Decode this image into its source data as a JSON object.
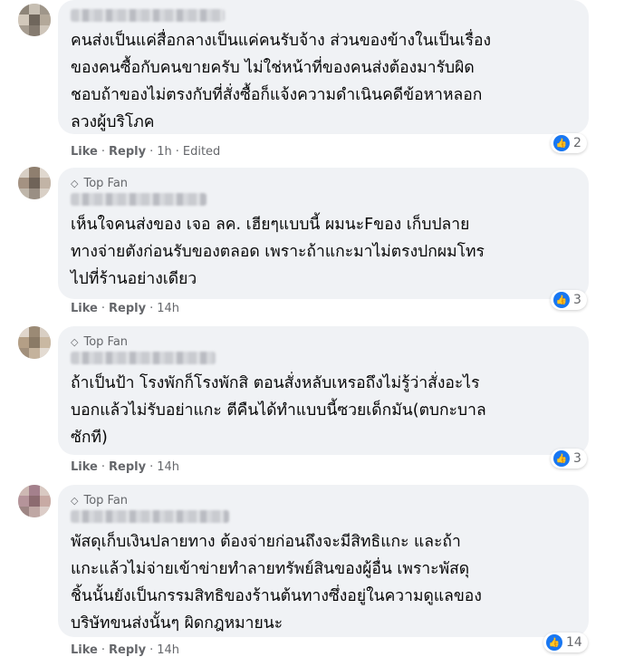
{
  "comments": [
    {
      "top_fan": false,
      "text": "คนส่งเป็นแค่สื่อกลางเป็นแค่คนรับจ้าง ส่วนของข้างในเป็นเรื่อง\nของคนซื้อกับคนขายครับ ไม่ใช่หน้าที่ของคนส่งต้องมารับผิด\nชอบถ้าของไม่ตรงกับที่สั่งซื้อก็แจ้งความดำเนินคดีข้อหาหลอก\nลวงผู้บริโภค",
      "like": "Like",
      "reply": "Reply",
      "time": "1h",
      "edited": "Edited",
      "reactions": "2"
    },
    {
      "top_fan": true,
      "badge": "Top Fan",
      "text": "เห็นใจคนส่งของ เจอ ลค. เฮียๆแบบนี้ ผมนะFของ เก็บปลาย\nทางจ่ายตังก่อนรับของตลอด เพราะถ้าแกะมาไม่ตรงปกผมโทร\nไปที่ร้านอย่างเดียว",
      "like": "Like",
      "reply": "Reply",
      "time": "14h",
      "reactions": "3"
    },
    {
      "top_fan": true,
      "badge": "Top Fan",
      "text": "ถ้าเป็นป้า โรงพักก็โรงพักสิ ตอนสั่งหลับเหรอถึงไม่รู้ว่าสั่งอะไร\nบอกแล้วไม่รับอย่าแกะ ตีคืนได้ทำแบบนี้ซวยเด็กมัน(ตบกะบาล\nซักที)",
      "like": "Like",
      "reply": "Reply",
      "time": "14h",
      "reactions": "3"
    },
    {
      "top_fan": true,
      "badge": "Top Fan",
      "text": "พัสดุเก็บเงินปลายทาง ต้องจ่ายก่อนถึงจะมีสิทธิแกะ และถ้า\nแกะแล้วไม่จ่ายเข้าข่ายทำลายทรัพย์สินของผู้อื่น เพราะพัสดุ\nชิ้นนั้นยังเป็นกรรมสิทธิของร้านต้นทางซึ่งอยู่ในความดูแลของ\nบริษัทขนส่งนั้นๆ ผิดกฎหมายนะ",
      "like": "Like",
      "reply": "Reply",
      "time": "14h",
      "reactions": "14"
    }
  ],
  "colors": {
    "bubble": "#f0f2f5",
    "meta": "#65676b",
    "like_blue": "#1877f2"
  },
  "icons": {
    "badge": "diamond-icon",
    "reaction": "thumbs-up-icon"
  }
}
